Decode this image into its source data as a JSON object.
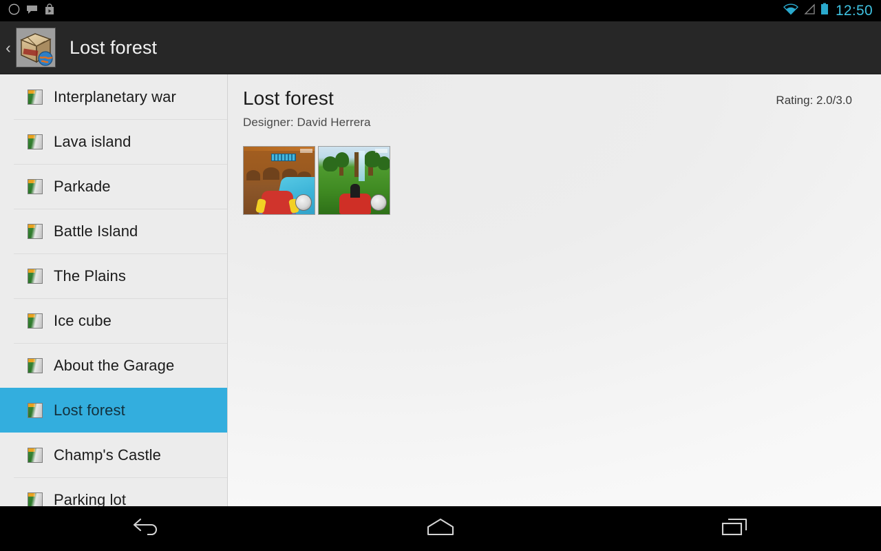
{
  "status_bar": {
    "notifications": [
      "circle-outline-icon",
      "speech-bubble-icon",
      "play-store-bag-icon"
    ],
    "wifi_icon": "wifi-icon",
    "signal_icon": "signal-triangle-icon",
    "battery_icon": "battery-full-icon",
    "clock": "12:50",
    "clock_color": "#3fc1e0"
  },
  "action_bar": {
    "up_chevron": "‹",
    "app_icon": "addons-package-globe-icon",
    "title": "Lost forest",
    "background": "#272727"
  },
  "sidebar": {
    "selected_index": 8,
    "highlight_color": "#33aede",
    "items": [
      {
        "label": "Interplanetary war",
        "icon": "track-thumbnail-icon"
      },
      {
        "label": "Lava island",
        "icon": "track-thumbnail-icon"
      },
      {
        "label": "Parkade",
        "icon": "track-thumbnail-icon"
      },
      {
        "label": "Battle Island",
        "icon": "track-thumbnail-icon"
      },
      {
        "label": "The Plains",
        "icon": "track-thumbnail-icon"
      },
      {
        "label": "Ice cube",
        "icon": "track-thumbnail-icon"
      },
      {
        "label": "About the Garage",
        "icon": "track-thumbnail-icon"
      },
      {
        "label": "Lost forest",
        "icon": "track-thumbnail-icon"
      },
      {
        "label": "Champ's Castle",
        "icon": "track-thumbnail-icon"
      },
      {
        "label": "Parking lot",
        "icon": "track-thumbnail-icon"
      }
    ]
  },
  "detail": {
    "title": "Lost forest",
    "designer": "Designer: David Herrera",
    "rating": "Rating: 2.0/3.0",
    "screenshots": [
      {
        "name": "screenshot-canyon-water"
      },
      {
        "name": "screenshot-forest-grass"
      }
    ]
  },
  "nav_bar": {
    "back": "back-icon",
    "home": "home-icon",
    "recents": "recents-icon"
  }
}
